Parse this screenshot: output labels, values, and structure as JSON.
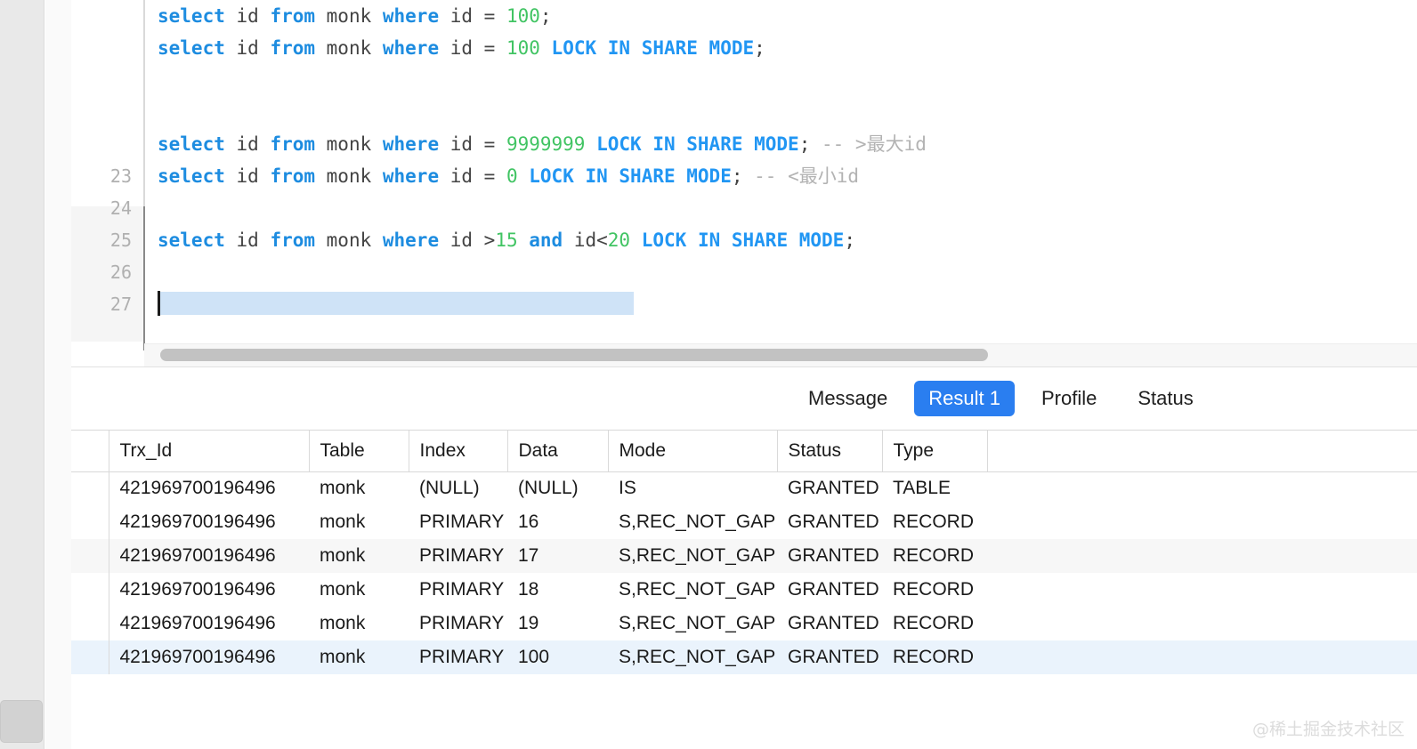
{
  "editor": {
    "lines": [
      {
        "lineno": "",
        "tokens": [
          {
            "t": "select",
            "c": "kw"
          },
          {
            "t": " id ",
            "c": "plain"
          },
          {
            "t": "from",
            "c": "kw"
          },
          {
            "t": " monk ",
            "c": "plain"
          },
          {
            "t": "where",
            "c": "kw"
          },
          {
            "t": " id = ",
            "c": "plain"
          },
          {
            "t": "100",
            "c": "num"
          },
          {
            "t": ";",
            "c": "plain"
          }
        ]
      },
      {
        "lineno": "",
        "tokens": [
          {
            "t": "select",
            "c": "kw"
          },
          {
            "t": " id ",
            "c": "plain"
          },
          {
            "t": "from",
            "c": "kw"
          },
          {
            "t": " monk ",
            "c": "plain"
          },
          {
            "t": "where",
            "c": "kw"
          },
          {
            "t": " id = ",
            "c": "plain"
          },
          {
            "t": "100",
            "c": "num"
          },
          {
            "t": " ",
            "c": "plain"
          },
          {
            "t": "LOCK IN SHARE MODE",
            "c": "kw2"
          },
          {
            "t": ";",
            "c": "plain"
          }
        ]
      },
      {
        "lineno": "",
        "tokens": []
      },
      {
        "lineno": "",
        "tokens": []
      },
      {
        "lineno": "",
        "tokens": [
          {
            "t": "select",
            "c": "kw"
          },
          {
            "t": " id ",
            "c": "plain"
          },
          {
            "t": "from",
            "c": "kw"
          },
          {
            "t": " monk ",
            "c": "plain"
          },
          {
            "t": "where",
            "c": "kw"
          },
          {
            "t": " id = ",
            "c": "plain"
          },
          {
            "t": "9999999",
            "c": "num"
          },
          {
            "t": " ",
            "c": "plain"
          },
          {
            "t": "LOCK IN SHARE MODE",
            "c": "kw2"
          },
          {
            "t": "; ",
            "c": "plain"
          },
          {
            "t": "-- >最大id",
            "c": "cmt"
          }
        ]
      },
      {
        "lineno": "23",
        "tokens": [
          {
            "t": "select",
            "c": "kw"
          },
          {
            "t": " id ",
            "c": "plain"
          },
          {
            "t": "from",
            "c": "kw"
          },
          {
            "t": " monk ",
            "c": "plain"
          },
          {
            "t": "where",
            "c": "kw"
          },
          {
            "t": " id = ",
            "c": "plain"
          },
          {
            "t": "0",
            "c": "num"
          },
          {
            "t": " ",
            "c": "plain"
          },
          {
            "t": "LOCK IN SHARE MODE",
            "c": "kw2"
          },
          {
            "t": "; ",
            "c": "plain"
          },
          {
            "t": "-- <最小id",
            "c": "cmt"
          }
        ]
      },
      {
        "lineno": "24",
        "tokens": []
      },
      {
        "lineno": "25",
        "tokens": [
          {
            "t": "select",
            "c": "kw"
          },
          {
            "t": " id ",
            "c": "plain"
          },
          {
            "t": "from",
            "c": "kw"
          },
          {
            "t": " monk ",
            "c": "plain"
          },
          {
            "t": "where",
            "c": "kw"
          },
          {
            "t": " id >",
            "c": "plain"
          },
          {
            "t": "15",
            "c": "num"
          },
          {
            "t": " ",
            "c": "plain"
          },
          {
            "t": "and",
            "c": "kw"
          },
          {
            "t": " id<",
            "c": "plain"
          },
          {
            "t": "20",
            "c": "num"
          },
          {
            "t": " ",
            "c": "plain"
          },
          {
            "t": "LOCK IN SHARE MODE",
            "c": "kw2"
          },
          {
            "t": ";",
            "c": "plain"
          }
        ]
      },
      {
        "lineno": "26",
        "tokens": []
      },
      {
        "lineno": "27",
        "tokens": [],
        "selected": true
      }
    ]
  },
  "tabs": [
    {
      "label": "Message",
      "active": false
    },
    {
      "label": "Result 1",
      "active": true
    },
    {
      "label": "Profile",
      "active": false
    },
    {
      "label": "Status",
      "active": false
    }
  ],
  "result_table": {
    "columns": [
      "Trx_Id",
      "Table",
      "Index",
      "Data",
      "Mode",
      "Status",
      "Type"
    ],
    "rows": [
      {
        "cells": [
          "421969700196496",
          "monk",
          "(NULL)",
          "(NULL)",
          "IS",
          "GRANTED",
          "TABLE"
        ],
        "nulls": [
          2,
          3
        ],
        "stripe": false,
        "selected": false
      },
      {
        "cells": [
          "421969700196496",
          "monk",
          "PRIMARY",
          "16",
          "S,REC_NOT_GAP",
          "GRANTED",
          "RECORD"
        ],
        "nulls": [],
        "stripe": false,
        "selected": false
      },
      {
        "cells": [
          "421969700196496",
          "monk",
          "PRIMARY",
          "17",
          "S,REC_NOT_GAP",
          "GRANTED",
          "RECORD"
        ],
        "nulls": [],
        "stripe": true,
        "selected": false
      },
      {
        "cells": [
          "421969700196496",
          "monk",
          "PRIMARY",
          "18",
          "S,REC_NOT_GAP",
          "GRANTED",
          "RECORD"
        ],
        "nulls": [],
        "stripe": false,
        "selected": false
      },
      {
        "cells": [
          "421969700196496",
          "monk",
          "PRIMARY",
          "19",
          "S,REC_NOT_GAP",
          "GRANTED",
          "RECORD"
        ],
        "nulls": [],
        "stripe": false,
        "selected": false
      },
      {
        "cells": [
          "421969700196496",
          "monk",
          "PRIMARY",
          "100",
          "S,REC_NOT_GAP",
          "GRANTED",
          "RECORD"
        ],
        "nulls": [],
        "stripe": false,
        "selected": true
      }
    ]
  },
  "watermark": {
    "text": "@稀土掘金技术社区"
  },
  "colors": {
    "accent": "#2a7ef0",
    "keyword": "#1d8ce0",
    "number": "#41c463",
    "comment": "#b3b3b3",
    "selection": "#cfe3f7",
    "row_selected": "#eaf3fc"
  }
}
